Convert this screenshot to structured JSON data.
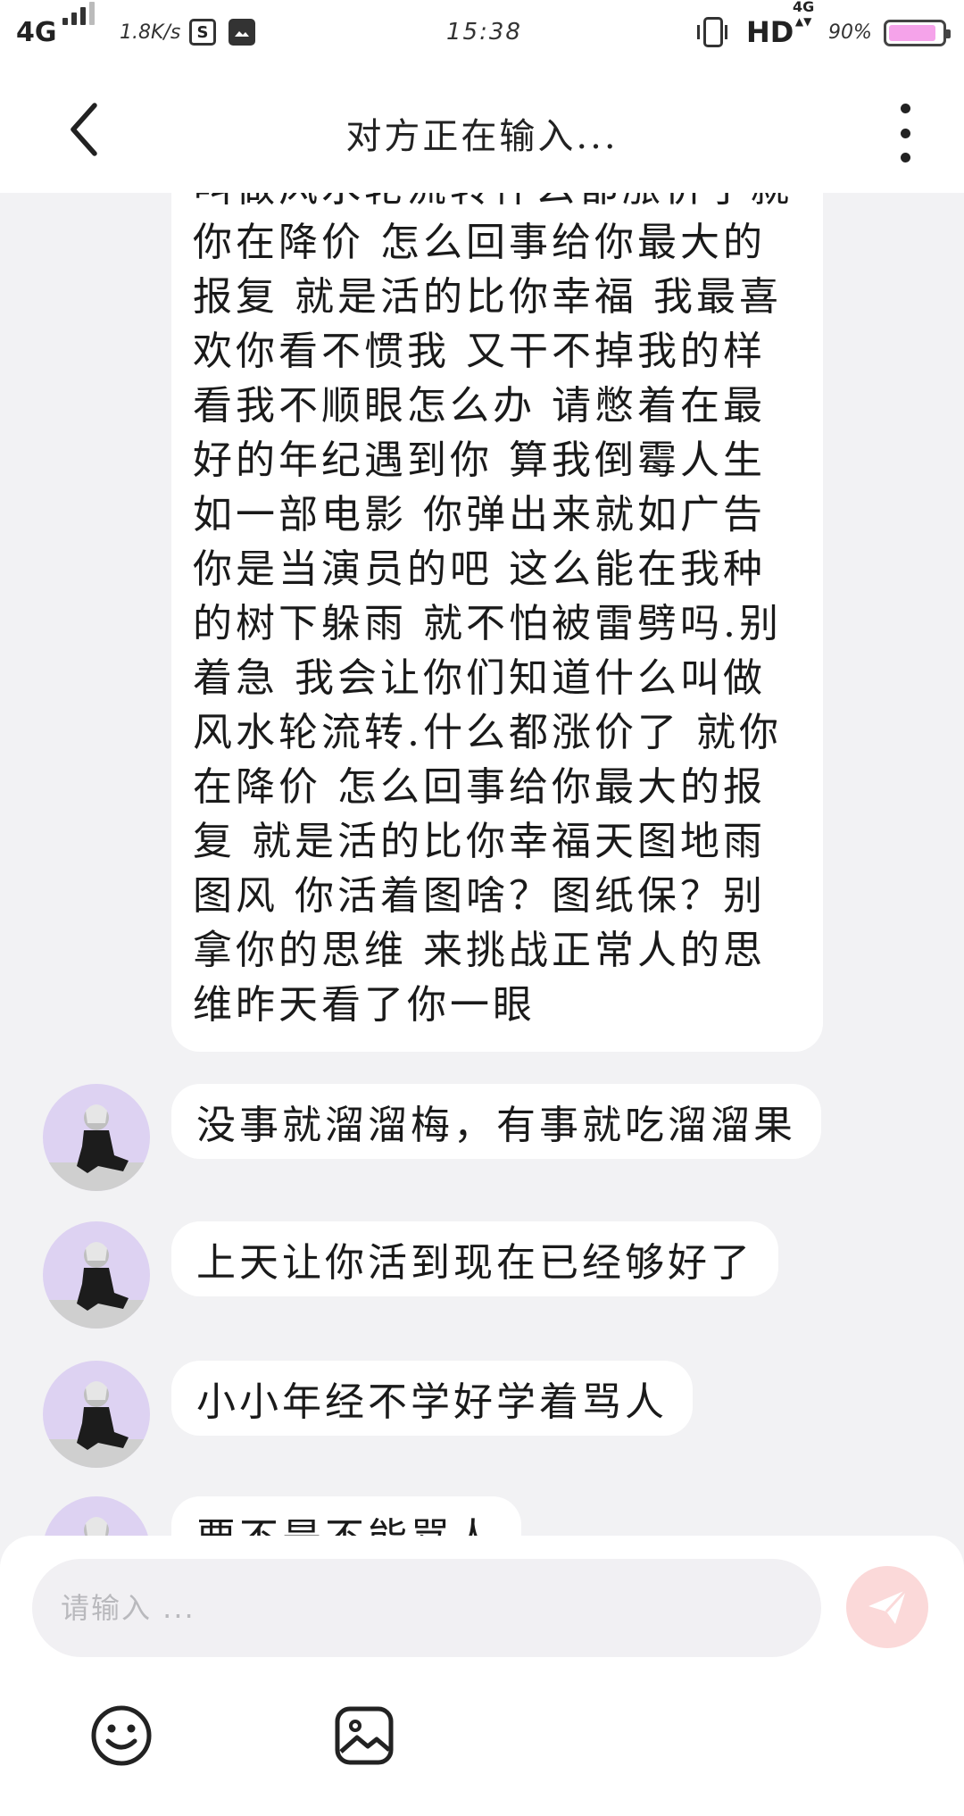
{
  "status_bar": {
    "network": "4G",
    "speed": "1.8K/s",
    "sim_icon": "S",
    "time": "15:38",
    "hd": "HD",
    "data_type": "4G",
    "battery": "90%",
    "battery_level": 0.9,
    "battery_color": "#f5a3ea"
  },
  "header": {
    "title": "对方正在输入...",
    "back_icon": "chevron-left-icon",
    "more_icon": "more-vertical-icon"
  },
  "messages": {
    "long_text": "叫做风水轮流转什么都涨价了就你在降价 怎么回事给你最大的报复 就是活的比你幸福 我最喜欢你看不惯我 又干不掉我的样看我不顺眼怎么办 请憋着在最好的年纪遇到你 算我倒霉人生如一部电影 你弹出来就如广告你是当演员的吧 这么能在我种的树下躲雨 就不怕被雷劈吗.别着急 我会让你们知道什么叫做风水轮流转.什么都涨价了 就你在降价 怎么回事给你最大的报复 就是活的比你幸福天图地雨图风 你活着图啥？图纸保？别拿你的思维 来挑战正常人的思维昨天看了你一眼",
    "short": [
      "没事就溜溜梅，有事就吃溜溜果",
      "上天让你活到现在已经够好了",
      "小小年经不学好学着骂人",
      "要不是不能骂人"
    ]
  },
  "composer": {
    "placeholder": "请输入 ...",
    "send_icon": "send-icon",
    "emoji_icon": "emoji-icon",
    "image_icon": "image-icon",
    "send_color": "#fbd9d9"
  }
}
